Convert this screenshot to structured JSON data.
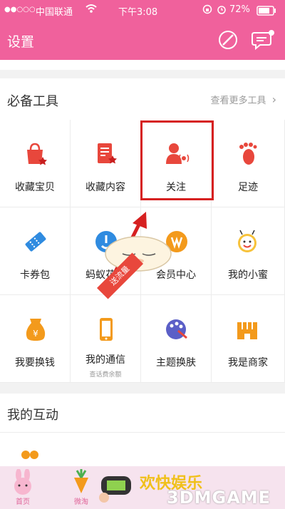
{
  "status": {
    "dots": "●●○○○",
    "carrier": "中国联通",
    "time": "下午3:08",
    "battery": "72%"
  },
  "header": {
    "title": "设置"
  },
  "tools": {
    "title": "必备工具",
    "more": "查看更多工具",
    "items": [
      {
        "label": "收藏宝贝",
        "icon": "shopping-bag-star-icon"
      },
      {
        "label": "收藏内容",
        "icon": "document-star-icon"
      },
      {
        "label": "关注",
        "icon": "follow-person-icon"
      },
      {
        "label": "足迹",
        "icon": "footprint-icon"
      },
      {
        "label": "卡券包",
        "icon": "ticket-icon"
      },
      {
        "label": "蚂蚁花呗",
        "icon": "ant-huabei-icon"
      },
      {
        "label": "会员中心",
        "icon": "member-center-icon"
      },
      {
        "label": "我的小蜜",
        "icon": "bee-face-icon"
      },
      {
        "label": "我要换钱",
        "icon": "money-bag-icon"
      },
      {
        "label": "我的通信",
        "icon": "phone-icon",
        "sub": "查话费余额"
      },
      {
        "label": "主题换肤",
        "icon": "palette-icon"
      },
      {
        "label": "我是商家",
        "icon": "shop-icon"
      }
    ]
  },
  "interact": {
    "title": "我的互动"
  },
  "banner": {
    "label": "送流量"
  },
  "tabs": [
    {
      "label": "首页"
    },
    {
      "label": "微淘"
    }
  ],
  "watermark": {
    "cn": "欢快娱乐",
    "en": "3DMGAME"
  },
  "colors": {
    "brand": "#f0619c",
    "icon_red": "#e8473c",
    "icon_blue": "#2f8be0",
    "icon_orange": "#f39a1c",
    "highlight": "#d62020"
  }
}
